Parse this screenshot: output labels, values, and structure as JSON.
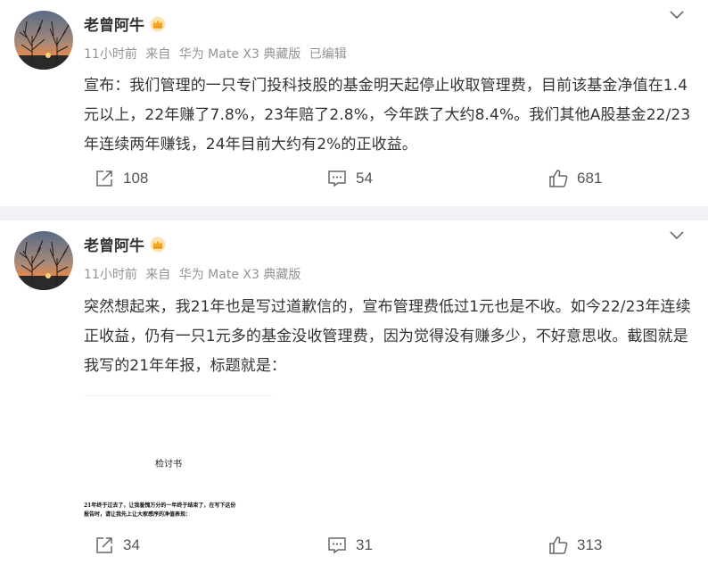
{
  "posts": [
    {
      "author": "老曾阿牛",
      "time": "11小时前",
      "source_prefix": "来自",
      "source": "华为 Mate X3 典藏版",
      "edited": "已编辑",
      "text": "宣布：我们管理的一只专门投科技股的基金明天起停止收取管理费，目前该基金净值在1.4元以上，22年赚了7.8%，23年赔了2.8%，今年跌了大约8.4%。我们其他A股基金22/23年连续两年赚钱，24年目前大约有2%的正收益。",
      "reposts": "108",
      "comments": "54",
      "likes": "681"
    },
    {
      "author": "老曾阿牛",
      "time": "11小时前",
      "source_prefix": "来自",
      "source": "华为 Mate X3 典藏版",
      "text": "突然想起来，我21年也是写过道歉信的，宣布管理费低过1元也是不收。如今22/23年连续正收益，仍有一只1元多的基金没收管理费，因为觉得没有赚多少，不好意思收。截图就是我写的21年年报，标题就是：",
      "image": {
        "title": "检讨书",
        "line1": "21年终于过去了，让我羞愧万分的一年终于结束了，在写下这份",
        "line2": "报告时，请让我先上让大家感序的净值表现："
      },
      "reposts": "34",
      "comments": "31",
      "likes": "313"
    }
  ],
  "icons": {
    "badge": "crown-icon",
    "menu": "chevron-down-icon",
    "repost": "repost-icon",
    "comment": "comment-icon",
    "like": "thumbs-up-icon"
  },
  "colors": {
    "text": "#333333",
    "meta": "#939393",
    "separator": "#f1f2f5",
    "badge": "#f5a623"
  }
}
